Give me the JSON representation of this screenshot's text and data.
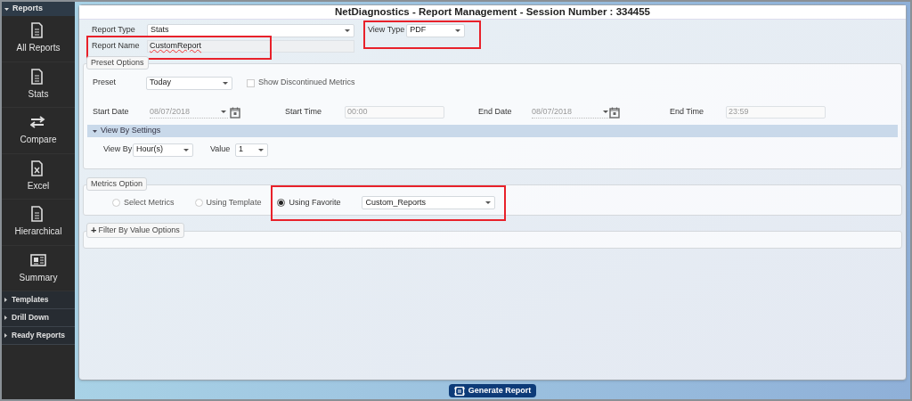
{
  "sidebar": {
    "header": {
      "label": "Reports",
      "expanded": true
    },
    "items": [
      {
        "label": "All Reports",
        "kind": "document"
      },
      {
        "label": "Stats",
        "kind": "document"
      },
      {
        "label": "Compare",
        "kind": "arrows"
      },
      {
        "label": "Excel",
        "kind": "excel"
      },
      {
        "label": "Hierarchical",
        "kind": "document"
      },
      {
        "label": "Summary",
        "kind": "newspaper"
      }
    ],
    "sections": [
      {
        "label": "Templates",
        "expanded": false
      },
      {
        "label": "Drill Down",
        "expanded": false
      },
      {
        "label": "Ready Reports",
        "expanded": false
      }
    ]
  },
  "title": "NetDiagnostics - Report Management - Session Number : 334455",
  "report_type": {
    "label": "Report Type",
    "value": "Stats"
  },
  "view_type": {
    "label": "View Type",
    "value": "PDF",
    "highlighted": true
  },
  "report_name": {
    "label": "Report Name",
    "value": "CustomReport",
    "highlighted": true
  },
  "preset_options": {
    "legend": "Preset Options",
    "preset": {
      "label": "Preset",
      "value": "Today"
    },
    "show_discontinued": {
      "label": "Show Discontinued Metrics",
      "checked": false
    },
    "start_date": {
      "label": "Start Date",
      "value": "08/07/2018",
      "disabled": true
    },
    "start_time": {
      "label": "Start Time",
      "value": "00:00",
      "disabled": true
    },
    "end_date": {
      "label": "End Date",
      "value": "08/07/2018",
      "disabled": true
    },
    "end_time": {
      "label": "End Time",
      "value": "23:59",
      "disabled": true
    },
    "view_by_settings": {
      "label": "View By Settings",
      "expanded": true,
      "view_by": {
        "label": "View By",
        "value": "Hour(s)"
      },
      "value": {
        "label": "Value",
        "value": "1"
      }
    }
  },
  "metrics_option": {
    "legend": "Metrics Option",
    "highlighted": true,
    "options": [
      {
        "label": "Select Metrics",
        "selected": false
      },
      {
        "label": "Using Template",
        "selected": false
      },
      {
        "label": "Using Favorite",
        "selected": true
      }
    ],
    "favorite": {
      "value": "Custom_Reports"
    }
  },
  "filter": {
    "icon": "+",
    "label": "Filter By Value Options"
  },
  "generate_button": "Generate Report"
}
